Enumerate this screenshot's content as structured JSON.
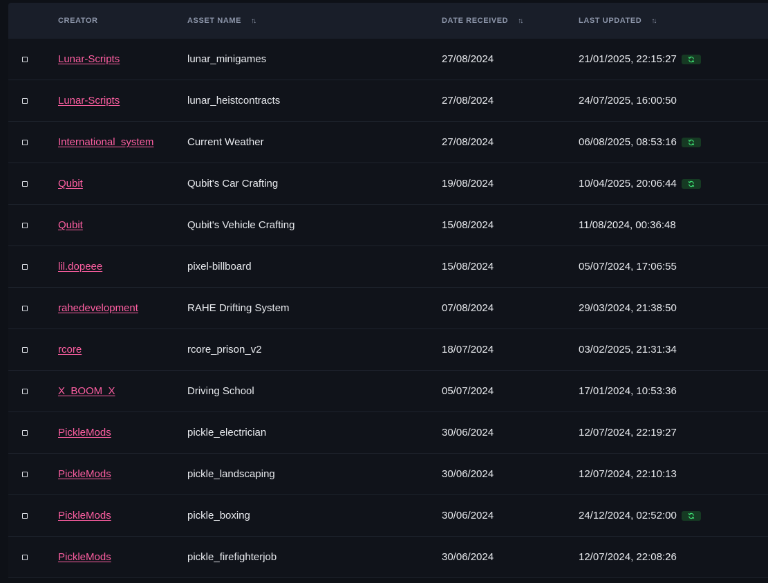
{
  "header": {
    "creator": "CREATOR",
    "asset_name": "ASSET NAME",
    "date_received": "DATE RECEIVED",
    "last_updated": "LAST UPDATED",
    "sort_icon": "sort-arrows-icon"
  },
  "colors": {
    "background": "#0e1117",
    "header_bg": "#191e29",
    "link": "#ff5fa2",
    "badge_bg": "#163a23",
    "badge_icon": "#3ddc72"
  },
  "rows": [
    {
      "creator": "Lunar-Scripts",
      "asset": "lunar_minigames",
      "received": "27/08/2024",
      "updated": "21/01/2025, 22:15:27",
      "badge": true
    },
    {
      "creator": "Lunar-Scripts",
      "asset": "lunar_heistcontracts",
      "received": "27/08/2024",
      "updated": "24/07/2025, 16:00:50",
      "badge": false
    },
    {
      "creator": "International_system",
      "asset": "Current Weather",
      "received": "27/08/2024",
      "updated": "06/08/2025, 08:53:16",
      "badge": true
    },
    {
      "creator": "Qubit",
      "asset": "Qubit's Car Crafting",
      "received": "19/08/2024",
      "updated": "10/04/2025, 20:06:44",
      "badge": true
    },
    {
      "creator": "Qubit",
      "asset": "Qubit's Vehicle Crafting",
      "received": "15/08/2024",
      "updated": "11/08/2024, 00:36:48",
      "badge": false
    },
    {
      "creator": "lil.dopeee",
      "asset": "pixel-billboard",
      "received": "15/08/2024",
      "updated": "05/07/2024, 17:06:55",
      "badge": false
    },
    {
      "creator": "rahedevelopment",
      "asset": "RAHE Drifting System",
      "received": "07/08/2024",
      "updated": "29/03/2024, 21:38:50",
      "badge": false
    },
    {
      "creator": "rcore",
      "asset": "rcore_prison_v2",
      "received": "18/07/2024",
      "updated": "03/02/2025, 21:31:34",
      "badge": false
    },
    {
      "creator": "X_BOOM_X",
      "asset": "Driving School",
      "received": "05/07/2024",
      "updated": "17/01/2024, 10:53:36",
      "badge": false
    },
    {
      "creator": "PickleMods",
      "asset": "pickle_electrician",
      "received": "30/06/2024",
      "updated": "12/07/2024, 22:19:27",
      "badge": false
    },
    {
      "creator": "PickleMods",
      "asset": "pickle_landscaping",
      "received": "30/06/2024",
      "updated": "12/07/2024, 22:10:13",
      "badge": false
    },
    {
      "creator": "PickleMods",
      "asset": "pickle_boxing",
      "received": "30/06/2024",
      "updated": "24/12/2024, 02:52:00",
      "badge": true
    },
    {
      "creator": "PickleMods",
      "asset": "pickle_firefighterjob",
      "received": "30/06/2024",
      "updated": "12/07/2024, 22:08:26",
      "badge": false
    }
  ]
}
